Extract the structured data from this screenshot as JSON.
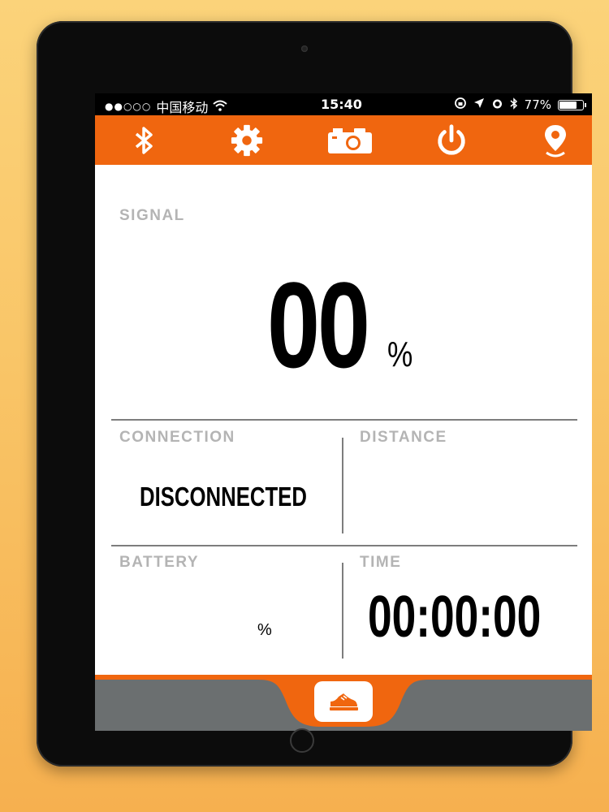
{
  "status_bar": {
    "carrier": "中国移动",
    "time": "15:40",
    "battery_percent": "77%",
    "battery_level": 0.77
  },
  "toolbar": {
    "icons": [
      "bluetooth-icon",
      "gear-icon",
      "camera-icon",
      "power-icon",
      "location-pin-icon"
    ]
  },
  "signal": {
    "label": "SIGNAL",
    "value": "00",
    "unit": "%"
  },
  "connection": {
    "label": "CONNECTION",
    "value": "DISCONNECTED"
  },
  "distance": {
    "label": "DISTANCE",
    "value": ""
  },
  "battery": {
    "label": "BATTERY",
    "value": "",
    "unit": "%"
  },
  "time": {
    "label": "TIME",
    "value": "00:00:00"
  },
  "colors": {
    "accent": "#f0660f",
    "label_gray": "#b4b4b4",
    "bottom_gray": "#6b6f70"
  }
}
